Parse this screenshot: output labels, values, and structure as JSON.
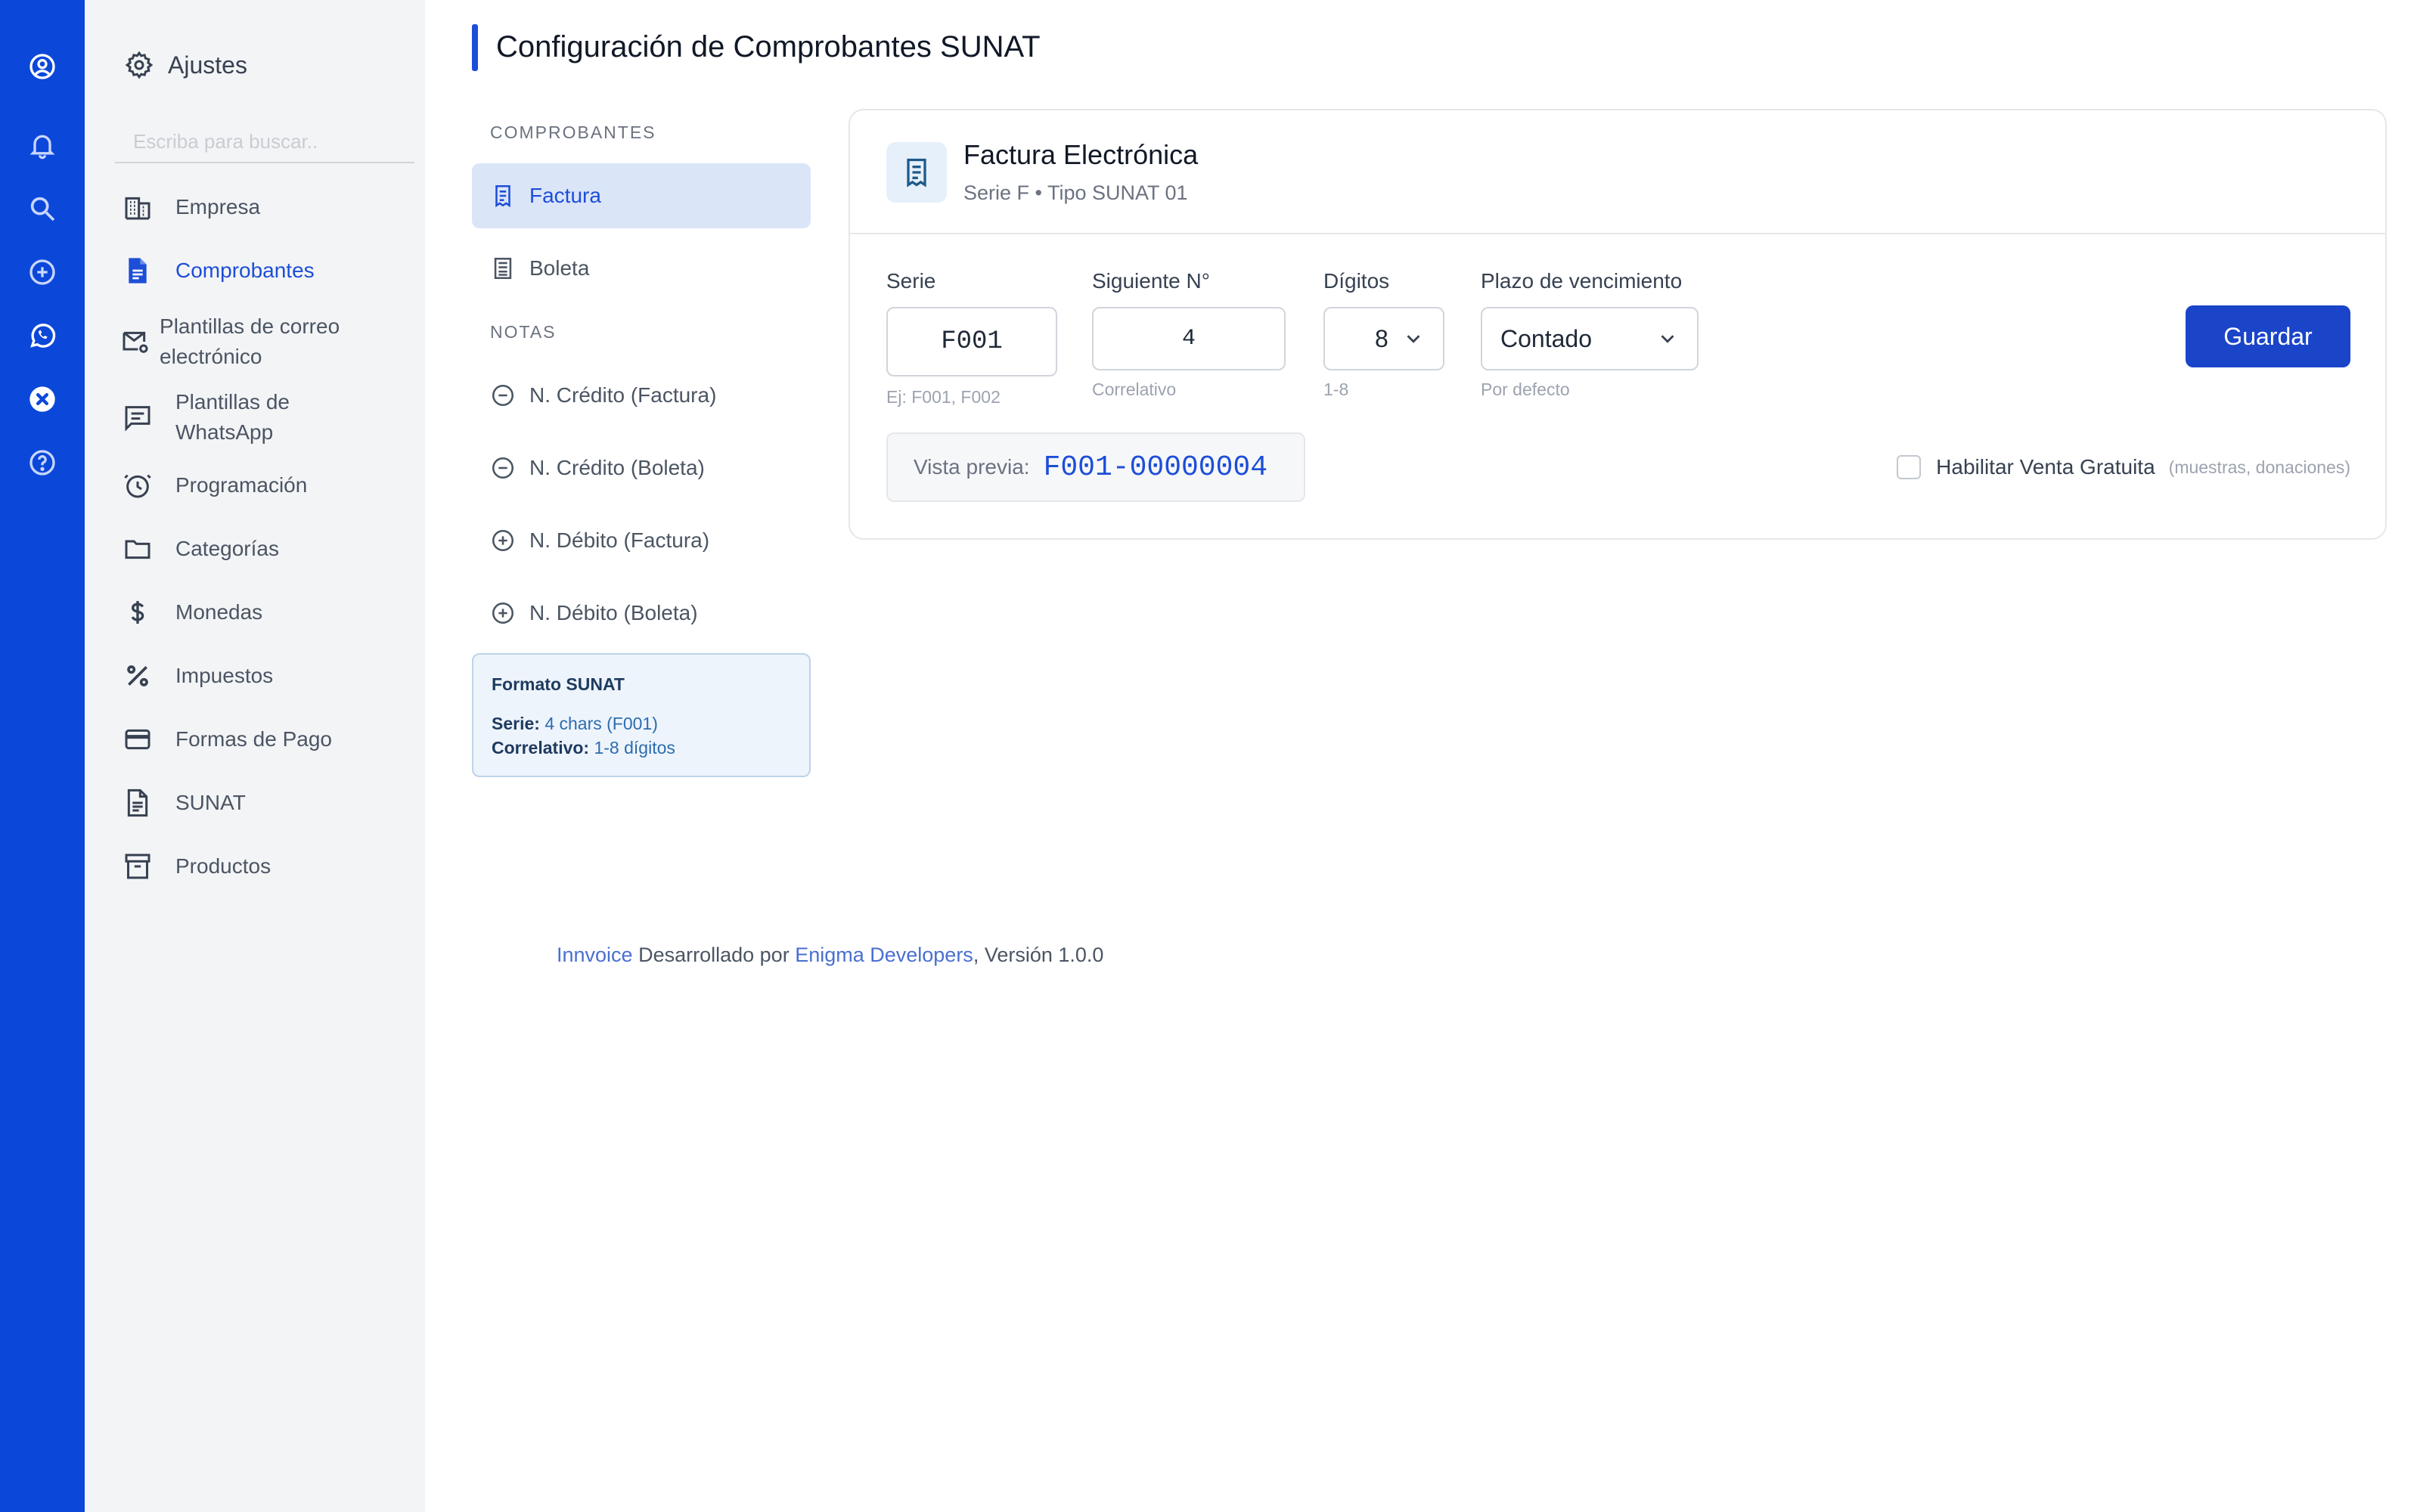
{
  "rail": {
    "icons": [
      "account-circle-icon",
      "bell-icon",
      "search-icon",
      "add-circle-icon",
      "whatsapp-icon",
      "close-circle-icon",
      "help-circle-icon"
    ],
    "color": "#0b47d9"
  },
  "sidebar": {
    "title": "Ajustes",
    "search_placeholder": "Escriba para buscar..",
    "items": [
      {
        "label": "Empresa",
        "icon": "building-icon"
      },
      {
        "label": "Comprobantes",
        "icon": "document-icon",
        "active": true
      },
      {
        "label": "Plantillas de correo electrónico",
        "icon": "mail-settings-icon"
      },
      {
        "label": "Plantillas de WhatsApp",
        "icon": "chat-lines-icon"
      },
      {
        "label": "Programación",
        "icon": "alarm-clock-icon"
      },
      {
        "label": "Categorías",
        "icon": "folder-icon"
      },
      {
        "label": "Monedas",
        "icon": "dollar-icon"
      },
      {
        "label": "Impuestos",
        "icon": "percent-icon"
      },
      {
        "label": "Formas de Pago",
        "icon": "credit-card-icon"
      },
      {
        "label": "SUNAT",
        "icon": "file-text-icon"
      },
      {
        "label": "Productos",
        "icon": "archive-box-icon"
      }
    ]
  },
  "page": {
    "title": "Configuración de Comprobantes SUNAT"
  },
  "doclist": {
    "section_comprobantes": "COMPROBANTES",
    "section_notas": "NOTAS",
    "comprobantes": [
      {
        "label": "Factura",
        "icon": "receipt-icon",
        "active": true
      },
      {
        "label": "Boleta",
        "icon": "list-doc-icon"
      }
    ],
    "notas": [
      {
        "label": "N. Crédito (Factura)",
        "icon": "minus-circle-icon"
      },
      {
        "label": "N. Crédito (Boleta)",
        "icon": "minus-circle-icon"
      },
      {
        "label": "N. Débito (Factura)",
        "icon": "plus-circle-icon"
      },
      {
        "label": "N. Débito (Boleta)",
        "icon": "plus-circle-icon"
      }
    ],
    "format_box": {
      "title": "Formato SUNAT",
      "serie_label": "Serie:",
      "serie_value": "4 chars (F001)",
      "correlativo_label": "Correlativo:",
      "correlativo_value": "1-8 dígitos"
    }
  },
  "card": {
    "title": "Factura Electrónica",
    "subtitle": "Serie F • Tipo SUNAT 01",
    "fields": {
      "serie": {
        "label": "Serie",
        "value": "F001",
        "hint": "Ej: F001, F002"
      },
      "siguiente": {
        "label": "Siguiente N°",
        "value": "4",
        "hint": "Correlativo"
      },
      "digitos": {
        "label": "Dígitos",
        "value": "8",
        "hint": "1-8"
      },
      "plazo": {
        "label": "Plazo de vencimiento",
        "value": "Contado",
        "hint": "Por defecto"
      }
    },
    "save_label": "Guardar",
    "preview_label": "Vista previa:",
    "preview_value": "F001-00000004",
    "gratuita_label": "Habilitar Venta Gratuita",
    "gratuita_note": "(muestras, donaciones)",
    "gratuita_checked": false
  },
  "footer": {
    "app_link": "Innvoice",
    "middle": " Desarrollado por ",
    "dev_link": "Enigma Developers",
    "version": ", Versión 1.0.0"
  },
  "colors": {
    "accent": "#1d4ed8",
    "button": "#1a45c9",
    "sidebar_bg": "#f3f4f6"
  }
}
